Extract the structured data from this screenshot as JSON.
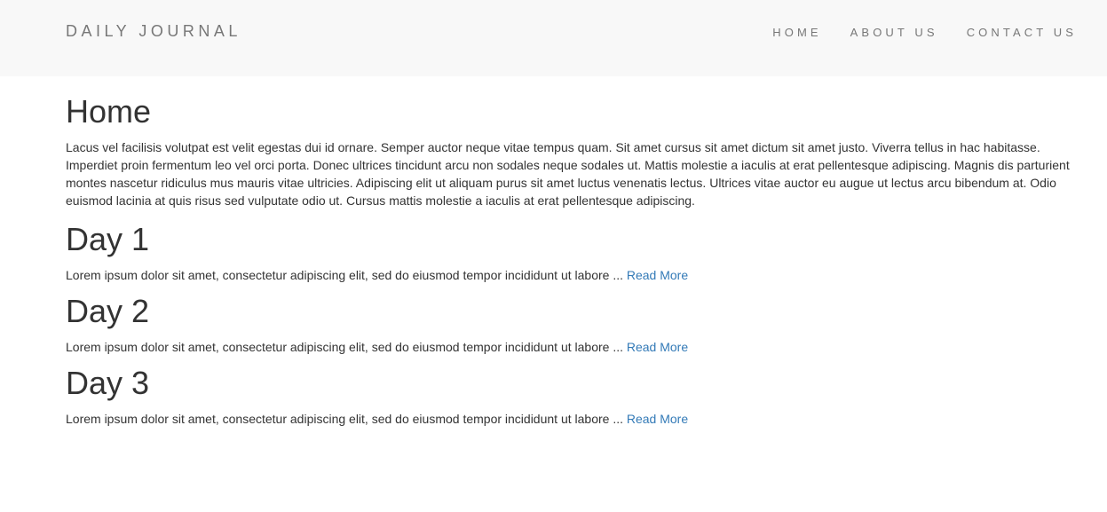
{
  "header": {
    "brand": "DAILY JOURNAL",
    "nav": [
      {
        "label": "HOME"
      },
      {
        "label": "ABOUT US"
      },
      {
        "label": "CONTACT US"
      }
    ]
  },
  "main": {
    "title": "Home",
    "intro": "Lacus vel facilisis volutpat est velit egestas dui id ornare. Semper auctor neque vitae tempus quam. Sit amet cursus sit amet dictum sit amet justo. Viverra tellus in hac habitasse. Imperdiet proin fermentum leo vel orci porta. Donec ultrices tincidunt arcu non sodales neque sodales ut. Mattis molestie a iaculis at erat pellentesque adipiscing. Magnis dis parturient montes nascetur ridiculus mus mauris vitae ultricies. Adipiscing elit ut aliquam purus sit amet luctus venenatis lectus. Ultrices vitae auctor eu augue ut lectus arcu bibendum at. Odio euismod lacinia at quis risus sed vulputate odio ut. Cursus mattis molestie a iaculis at erat pellentesque adipiscing.",
    "posts": [
      {
        "title": "Day 1",
        "excerpt": "Lorem ipsum dolor sit amet, consectetur adipiscing elit, sed do eiusmod tempor incididunt ut labore ... ",
        "link": "Read More"
      },
      {
        "title": "Day 2",
        "excerpt": "Lorem ipsum dolor sit amet, consectetur adipiscing elit, sed do eiusmod tempor incididunt ut labore ... ",
        "link": "Read More"
      },
      {
        "title": "Day 3",
        "excerpt": "Lorem ipsum dolor sit amet, consectetur adipiscing elit, sed do eiusmod tempor incididunt ut labore ... ",
        "link": "Read More"
      }
    ]
  },
  "colors": {
    "navbar_bg": "#f8f8f8",
    "nav_text": "#777777",
    "body_text": "#333333",
    "link": "#337ab7"
  }
}
